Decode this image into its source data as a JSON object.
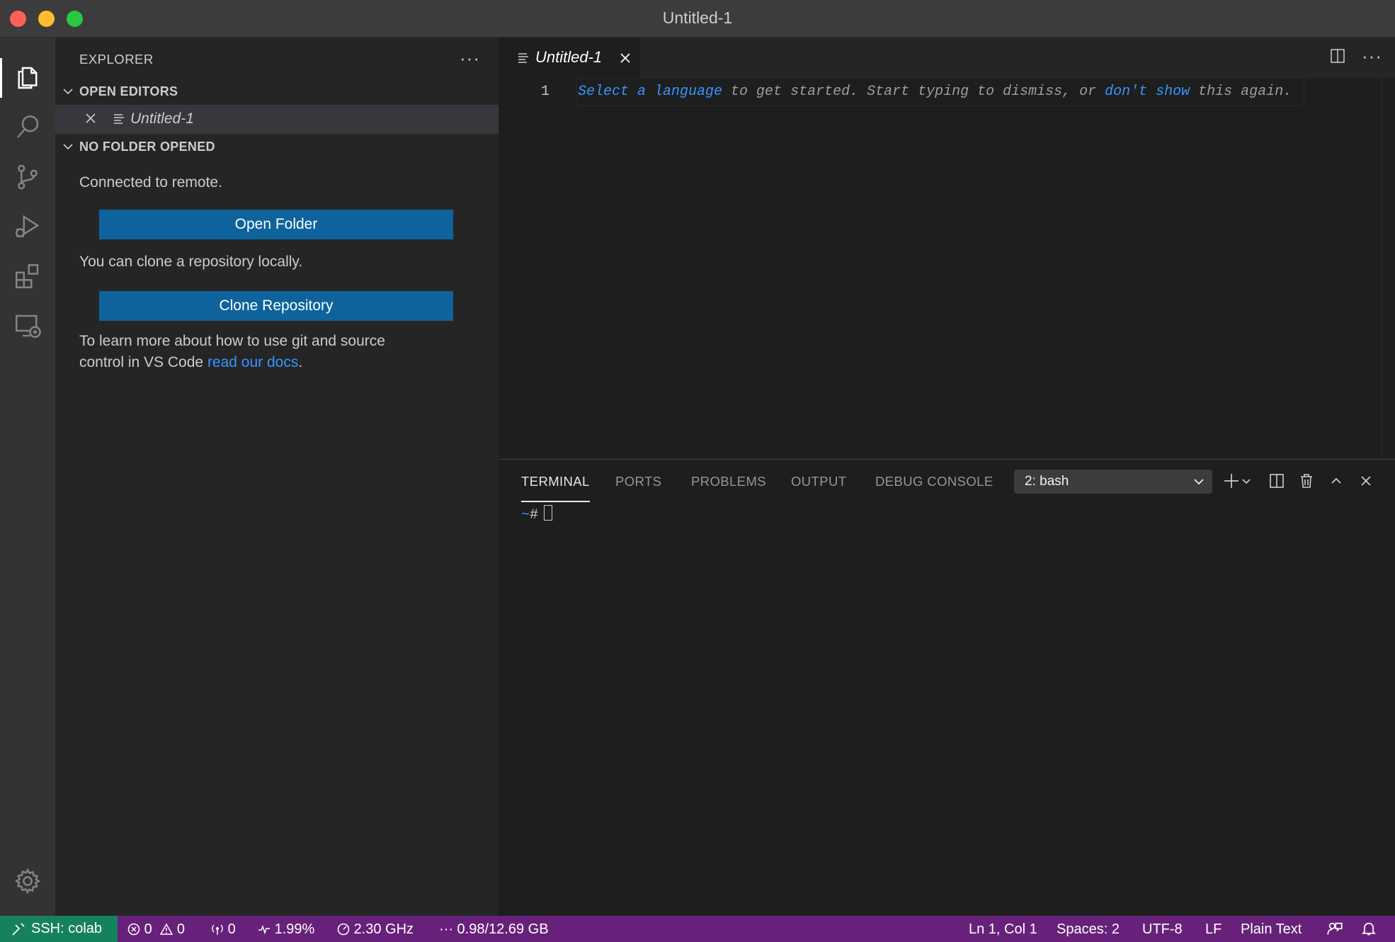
{
  "window": {
    "title": "Untitled-1"
  },
  "sidebar": {
    "header": "EXPLORER",
    "more": "···",
    "open_editors": {
      "title": "OPEN EDITORS",
      "items": [
        {
          "name": "Untitled-1"
        }
      ]
    },
    "no_folder": {
      "title": "NO FOLDER OPENED",
      "connected_text": "Connected to remote.",
      "open_folder_label": "Open Folder",
      "clone_text": "You can clone a repository locally.",
      "clone_label": "Clone Repository",
      "learn_line1": "To learn more about how to use git and source",
      "learn_line2_prefix": "control in VS Code ",
      "learn_link": "read our docs",
      "learn_suffix": "."
    }
  },
  "editor": {
    "tab": {
      "name": "Untitled-1"
    },
    "more": "···",
    "line_number": "1",
    "hint": {
      "part1": "Select a language",
      "part2": " to get started. Start typing to dismiss, or ",
      "part3": "don't show",
      "part4": " this again."
    }
  },
  "panel": {
    "tabs": [
      {
        "label": "TERMINAL",
        "active": true
      },
      {
        "label": "PORTS"
      },
      {
        "label": "PROBLEMS"
      },
      {
        "label": "OUTPUT"
      },
      {
        "label": "DEBUG CONSOLE"
      }
    ],
    "terminal_select": "2: bash",
    "prompt_tilde": "~",
    "prompt_hash": "#"
  },
  "statusbar": {
    "remote": "SSH: colab",
    "errors": "0",
    "warnings": "0",
    "ports": "0",
    "cpu": "1.99%",
    "freq": "2.30 GHz",
    "memory": "0.98/12.69 GB",
    "position": "Ln 1, Col 1",
    "spaces": "Spaces: 2",
    "encoding": "UTF-8",
    "eol": "LF",
    "language": "Plain Text"
  },
  "colors": {
    "accent": "#0e639c",
    "link": "#3794ff",
    "statusbar": "#68217a",
    "remote": "#16825d"
  },
  "icons": {
    "activity": [
      "explorer-icon",
      "search-icon",
      "source-control-icon",
      "run-debug-icon",
      "extensions-icon",
      "remote-explorer-icon",
      "gear-icon"
    ]
  }
}
